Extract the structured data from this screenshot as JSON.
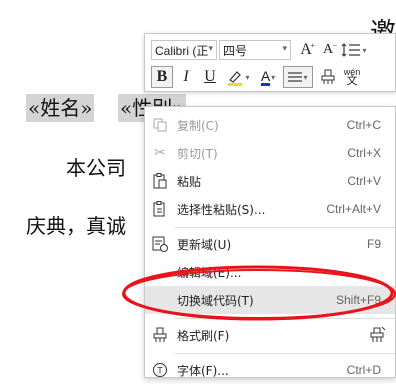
{
  "document": {
    "heading_fragment": "邀",
    "merge_fields": [
      "«姓名»",
      "«性别»"
    ],
    "merge_field_tail": "，",
    "line2_text": "本公司",
    "line3_text": "庆典，真诚"
  },
  "mini_toolbar": {
    "font_name": "Calibri (正",
    "font_size": "四号",
    "grow_font_label": "A",
    "shrink_font_label": "A",
    "bold_label": "B",
    "italic_label": "I",
    "underline_label": "U",
    "font_color_label": "A",
    "phonetic_label": "wén",
    "colors": {
      "highlight": "#f5d52a",
      "font_color": "#1a2bd8"
    }
  },
  "context_menu": {
    "items": [
      {
        "label": "复制(C)",
        "shortcut": "Ctrl+C",
        "icon": "copy-icon",
        "disabled": true
      },
      {
        "label": "剪切(T)",
        "shortcut": "Ctrl+X",
        "icon": "cut-icon",
        "disabled": true
      },
      {
        "label": "粘贴",
        "shortcut": "Ctrl+V",
        "icon": "paste-icon",
        "disabled": false
      },
      {
        "label": "选择性粘贴(S)...",
        "shortcut": "Ctrl+Alt+V",
        "icon": "paste-special-icon",
        "disabled": false
      },
      {
        "label": "更新域(U)",
        "shortcut": "F9",
        "icon": "update-field-icon",
        "disabled": false
      },
      {
        "label": "编辑域(E)...",
        "shortcut": "",
        "icon": "",
        "disabled": false
      },
      {
        "label": "切换域代码(T)",
        "shortcut": "Shift+F9",
        "icon": "",
        "disabled": false,
        "highlighted": true
      },
      {
        "label": "格式刷(F)",
        "shortcut": "",
        "icon": "format-painter-icon",
        "disabled": false
      },
      {
        "label": "字体(F)...",
        "shortcut": "Ctrl+D",
        "icon": "font-icon",
        "disabled": false
      }
    ]
  },
  "annotation": {
    "color": "#e8141b"
  }
}
